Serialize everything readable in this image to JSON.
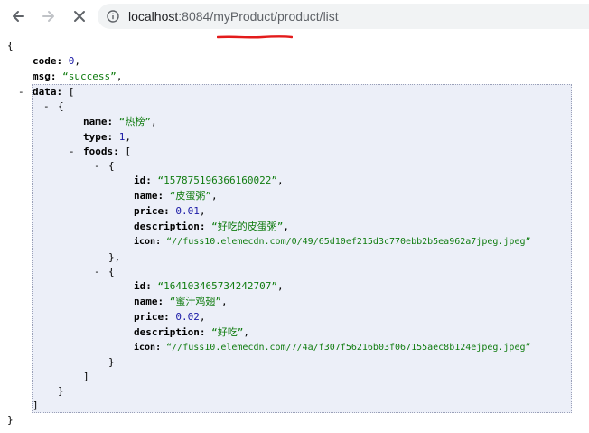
{
  "browser": {
    "url_host": "localhost",
    "url_rest": ":8084/myProduct/product/list"
  },
  "json": {
    "open_brace": "{",
    "close_brace": "}",
    "code_key": "code:",
    "code_val": "0",
    "msg_key": "msg:",
    "msg_val": "“success”",
    "data_key": "data:",
    "bracket_open": "[",
    "bracket_close": "]",
    "toggle": "-",
    "obj_open": "{",
    "obj_close": "}",
    "obj_close_comma": "},",
    "comma": ",",
    "name_key": "name:",
    "type_key": "type:",
    "foods_key": "foods:",
    "id_key": "id:",
    "price_key": "price:",
    "description_key": "description:",
    "icon_key": "icon:",
    "category": {
      "name": "“热榜”",
      "type": "1"
    },
    "foods": [
      {
        "id": "“157875196366160022”",
        "name": "“皮蛋粥”",
        "price": "0.01",
        "description": "“好吃的皮蛋粥”",
        "icon": "“//fuss10.elemecdn.com/0/49/65d10ef215d3c770ebb2b5ea962a7jpeg.jpeg”"
      },
      {
        "id": "“164103465734242707”",
        "name": "“蜜汁鸡翅”",
        "price": "0.02",
        "description": "“好吃”",
        "icon": "“//fuss10.elemecdn.com/7/4a/f307f56216b03f067155aec8b124ejpeg.jpeg”"
      }
    ]
  },
  "colors": {
    "annotation": "#e31b1b",
    "number": "#1a1aa6",
    "string": "#107c10"
  }
}
